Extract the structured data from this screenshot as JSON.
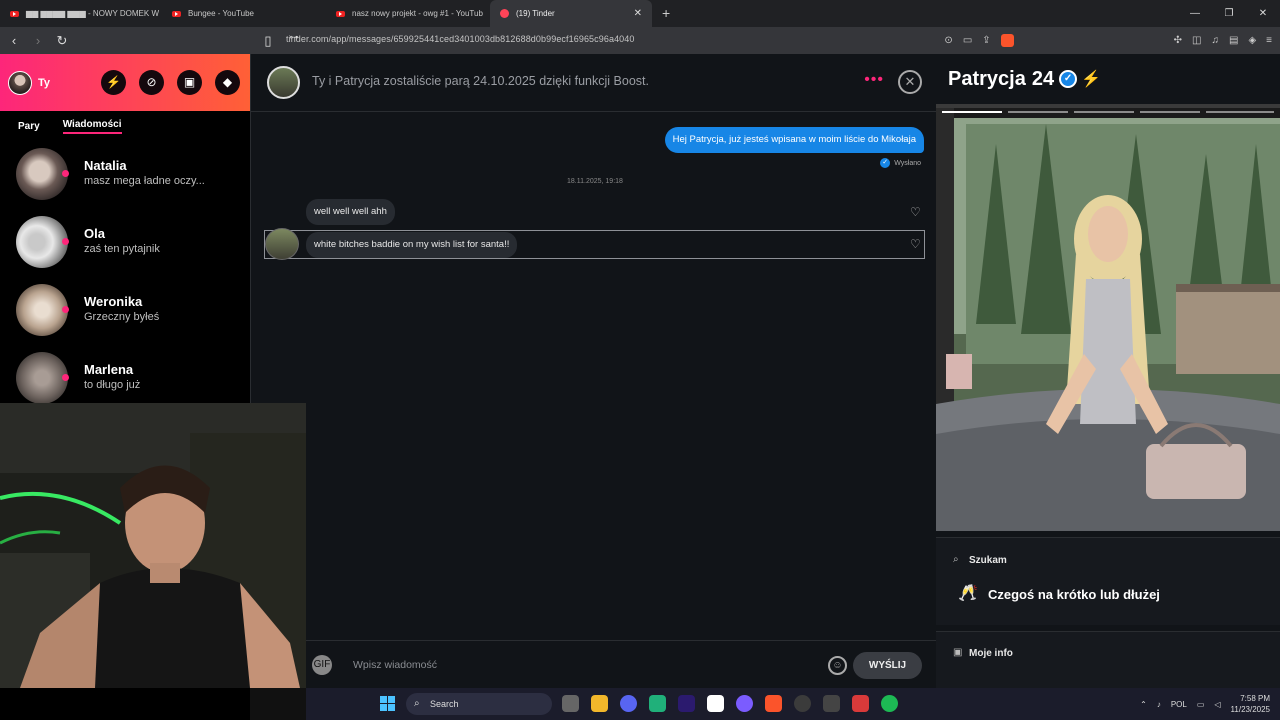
{
  "browser": {
    "tabs": [
      {
        "title": "▆▆ ▆▆▆▆ ▆▆▆ - NOWY DOMEK W",
        "icon": "youtube-icon"
      },
      {
        "title": "Bungee - YouTube",
        "icon": "youtube-icon"
      },
      {
        "title": "nasz nowy projekt - owg #1 - YouTub",
        "icon": "youtube-icon"
      },
      {
        "title": "(19) Tinder",
        "icon": "tinder-icon",
        "active": true
      }
    ],
    "new_tab": "+",
    "url": "tinder.com/app/messages/659925441ced3401003db812688d0b99ecf16965c96a4040"
  },
  "sidebar": {
    "user_name": "Ty",
    "tabs": {
      "matches": "Pary",
      "messages": "Wiadomości"
    },
    "matches": [
      {
        "name": "Natalia",
        "last": "masz mega ładne oczy..."
      },
      {
        "name": "Ola",
        "last": "zaś ten pytajnik"
      },
      {
        "name": "Weronika",
        "last": "Grzeczny byłeś"
      },
      {
        "name": "Marlena",
        "last": "to długo już"
      }
    ]
  },
  "chat": {
    "header": "Ty i Patrycja zostaliście parą 24.10.2025 dzięki funkcji Boost.",
    "outgoing": "Hej Patrycja, już jesteś wpisana w moim liście do Mikołaja",
    "status": "Wysłano",
    "timestamp": "18.11.2025, 19:18",
    "incoming": [
      "well well well ahh",
      "white bitches baddie on my wish list for santa!!"
    ],
    "placeholder": "Wpisz wiadomość",
    "send_label": "WYŚLIJ",
    "gif_label": "GIF"
  },
  "profile": {
    "name": "Patrycja",
    "age": "24",
    "looking_label": "Szukam",
    "looking_value": "Czegoś na krótko lub dłużej",
    "info_label": "Moje info"
  },
  "taskbar": {
    "search": "Search",
    "lang": "POL",
    "time": "7:58 PM",
    "date": "11/23/2025"
  },
  "colors": {
    "tinder_pink": "#fd267a",
    "tinder_orange": "#ff6036",
    "message_blue": "#1786e6",
    "boost_purple": "#a56bff"
  }
}
